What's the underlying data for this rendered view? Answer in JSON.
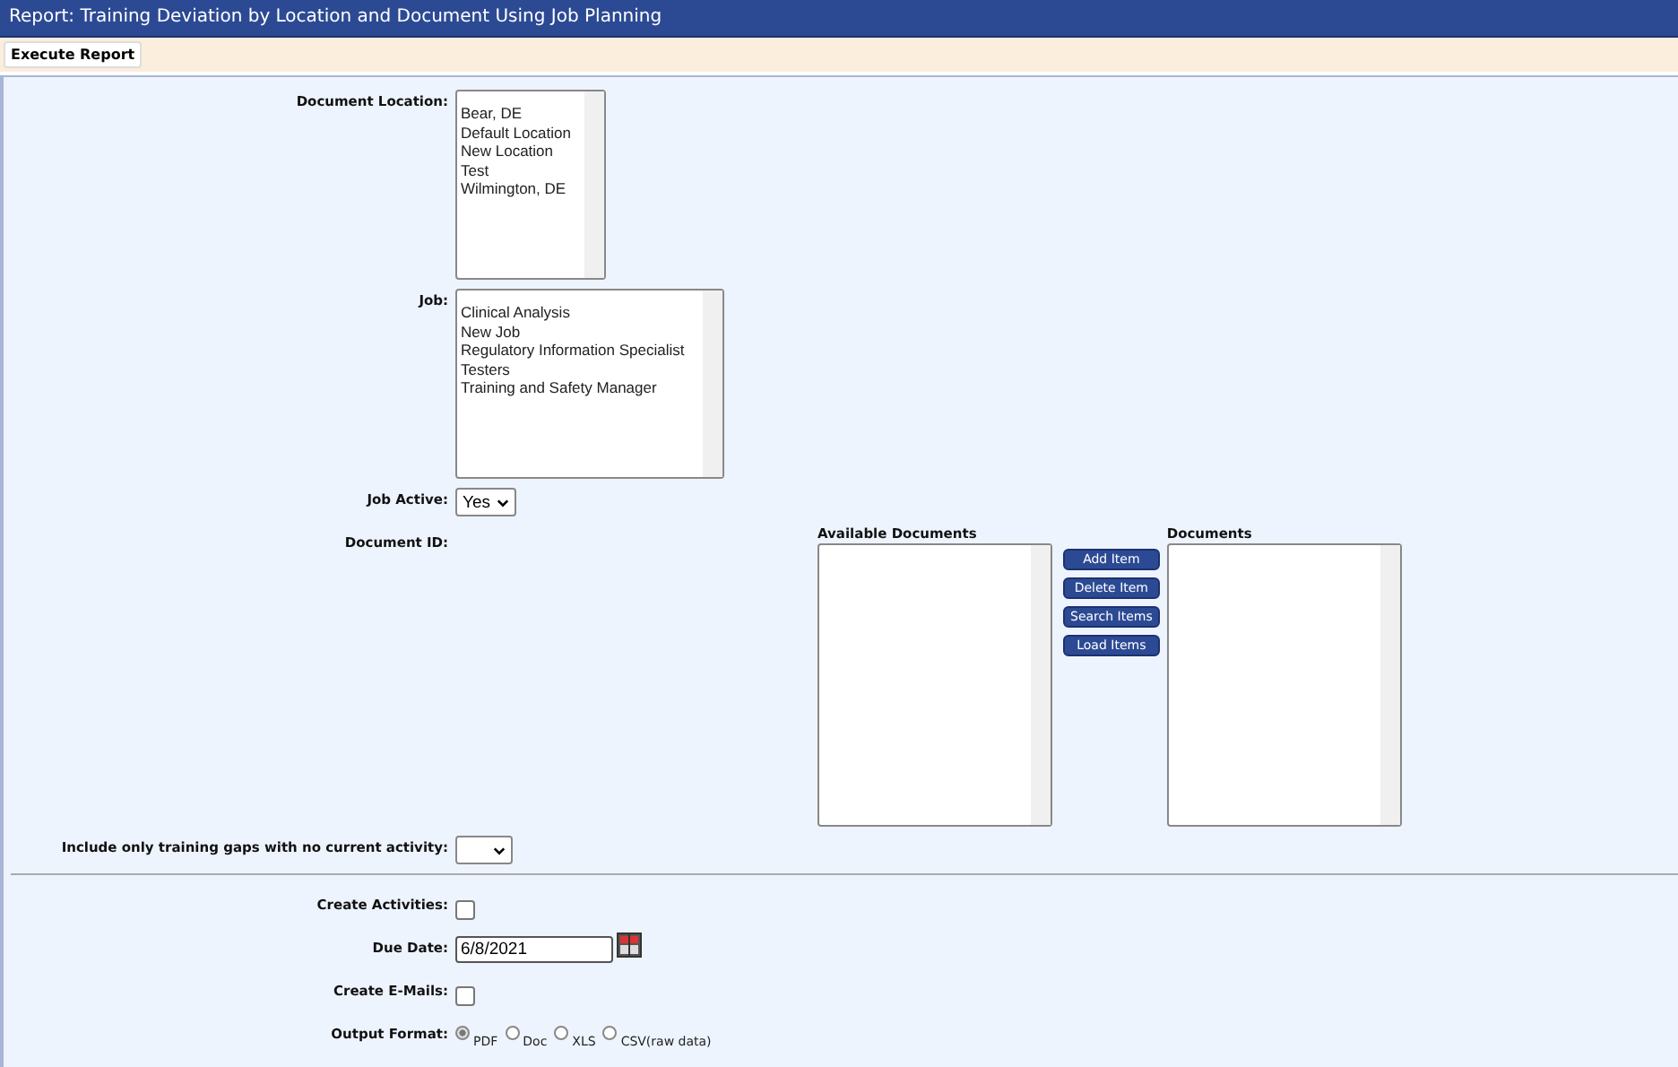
{
  "window": {
    "title": "Report: Training Deviation by Location and Document Using Job Planning"
  },
  "toolbar": {
    "buttons": [
      "Execute Report"
    ]
  },
  "document_location": {
    "label": "Document Location:",
    "options": [
      "Bear, DE",
      "Default Location",
      "New Location",
      "Test",
      "Wilmington, DE"
    ]
  },
  "job": {
    "label": "Job:",
    "options": [
      "Clinical Analysis",
      "New Job",
      "Regulatory Information Specialist",
      "Testers",
      "Training and Safety Manager"
    ]
  },
  "job_active": {
    "label": "Job Active:",
    "value": "Yes"
  },
  "document_id": {
    "label": "Document ID:",
    "available_header": "Available Documents",
    "selected_header": "Documents",
    "buttons": [
      "Add Item",
      "Delete Item",
      "Search Items",
      "Load Items"
    ]
  },
  "no_activity": {
    "label": "Include only training gaps with no current activity:"
  },
  "create_activities": {
    "label": "Create Activities:",
    "checked": false
  },
  "due_date": {
    "label": "Due Date:",
    "value": "6/8/2021"
  },
  "create_emails": {
    "label": "Create E-Mails:",
    "checked": false
  },
  "output_format": {
    "label": "Output Format:",
    "options": [
      {
        "label": "PDF",
        "selected": true
      },
      {
        "label": "Doc",
        "selected": false
      },
      {
        "label": "XLS",
        "selected": false
      },
      {
        "label": "CSV(raw data)",
        "selected": false
      }
    ]
  }
}
